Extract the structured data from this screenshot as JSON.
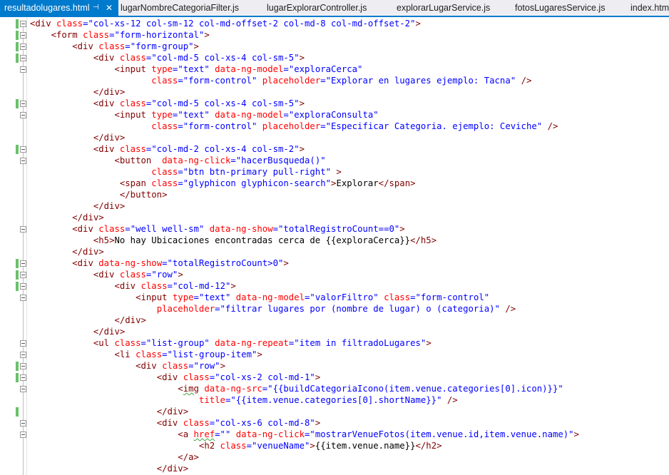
{
  "tabs": [
    {
      "label": "resultadolugares.html",
      "active": true
    },
    {
      "label": "lugarNombreCategoriaFilter.js",
      "active": false
    },
    {
      "label": "lugarExplorarController.js",
      "active": false
    },
    {
      "label": "explorarLugarService.js",
      "active": false
    },
    {
      "label": "fotosLugaresService.js",
      "active": false
    },
    {
      "label": "index.htm",
      "active": false
    }
  ],
  "tab_pin_icon": "⊣",
  "tab_close_icon": "✕",
  "syntax_colors": {
    "tag": "#800000",
    "attr": "#ff0000",
    "value": "#0000ff",
    "text": "#000000"
  },
  "code_lines": [
    "<div class=\"col-xs-12 col-sm-12 col-md-offset-2 col-md-8 col-md-offset-2\">",
    "    <form class=\"form-horizontal\">",
    "        <div class=\"form-group\">",
    "            <div class=\"col-md-5 col-xs-4 col-sm-5\">",
    "                <input type=\"text\" data-ng-model=\"exploraCerca\"",
    "                       class=\"form-control\" placeholder=\"Explorar en lugares ejemplo: Tacna\" />",
    "            </div>",
    "            <div class=\"col-md-5 col-xs-4 col-sm-5\">",
    "                <input type=\"text\" data-ng-model=\"exploraConsulta\"",
    "                       class=\"form-control\" placeholder=\"Especificar Categoria. ejemplo: Ceviche\" />",
    "            </div>",
    "            <div class=\"col-md-2 col-xs-4 col-sm-2\">",
    "                <button  data-ng-click=\"hacerBusqueda()\"",
    "                       class=\"btn btn-primary pull-right\" >",
    "                 <span class=\"glyphicon glyphicon-search\">Explorar</span>",
    "                 </button>",
    "            </div>",
    "        </div>",
    "        <div class=\"well well-sm\" data-ng-show=\"totalRegistroCount==0\">",
    "            <h5>No hay Ubicaciones encontradas cerca de {{exploraCerca}}</h5>",
    "        </div>",
    "        <div data-ng-show=\"totalRegistroCount>0\">",
    "            <div class=\"row\">",
    "                <div class=\"col-md-12\">",
    "                    <input type=\"text\" data-ng-model=\"valorFiltro\" class=\"form-control\"",
    "                        placeholder=\"filtrar lugares por (nombre de lugar) o (categoria)\" />",
    "                </div>",
    "            </div>",
    "            <ul class=\"list-group\" data-ng-repeat=\"item in filtradoLugares\">",
    "                <li class=\"list-group-item\">",
    "                    <div class=\"row\">",
    "                        <div class=\"col-xs-2 col-md-1\">",
    "                            <img data-ng-src=\"{{buildCategoriaIcono(item.venue.categories[0].icon)}}\"",
    "                                title=\"{{item.venue.categories[0].shortName}}\" />",
    "                        </div>",
    "                        <div class=\"col-xs-6 col-md-8\">",
    "                            <a href=\"\" data-ng-click=\"mostrarVenueFotos(item.venue.id,item.venue.name)\">",
    "                                <h2 class=\"venueName\">{{item.venue.name}}</h2>",
    "                            </a>",
    "                        </div>"
  ]
}
